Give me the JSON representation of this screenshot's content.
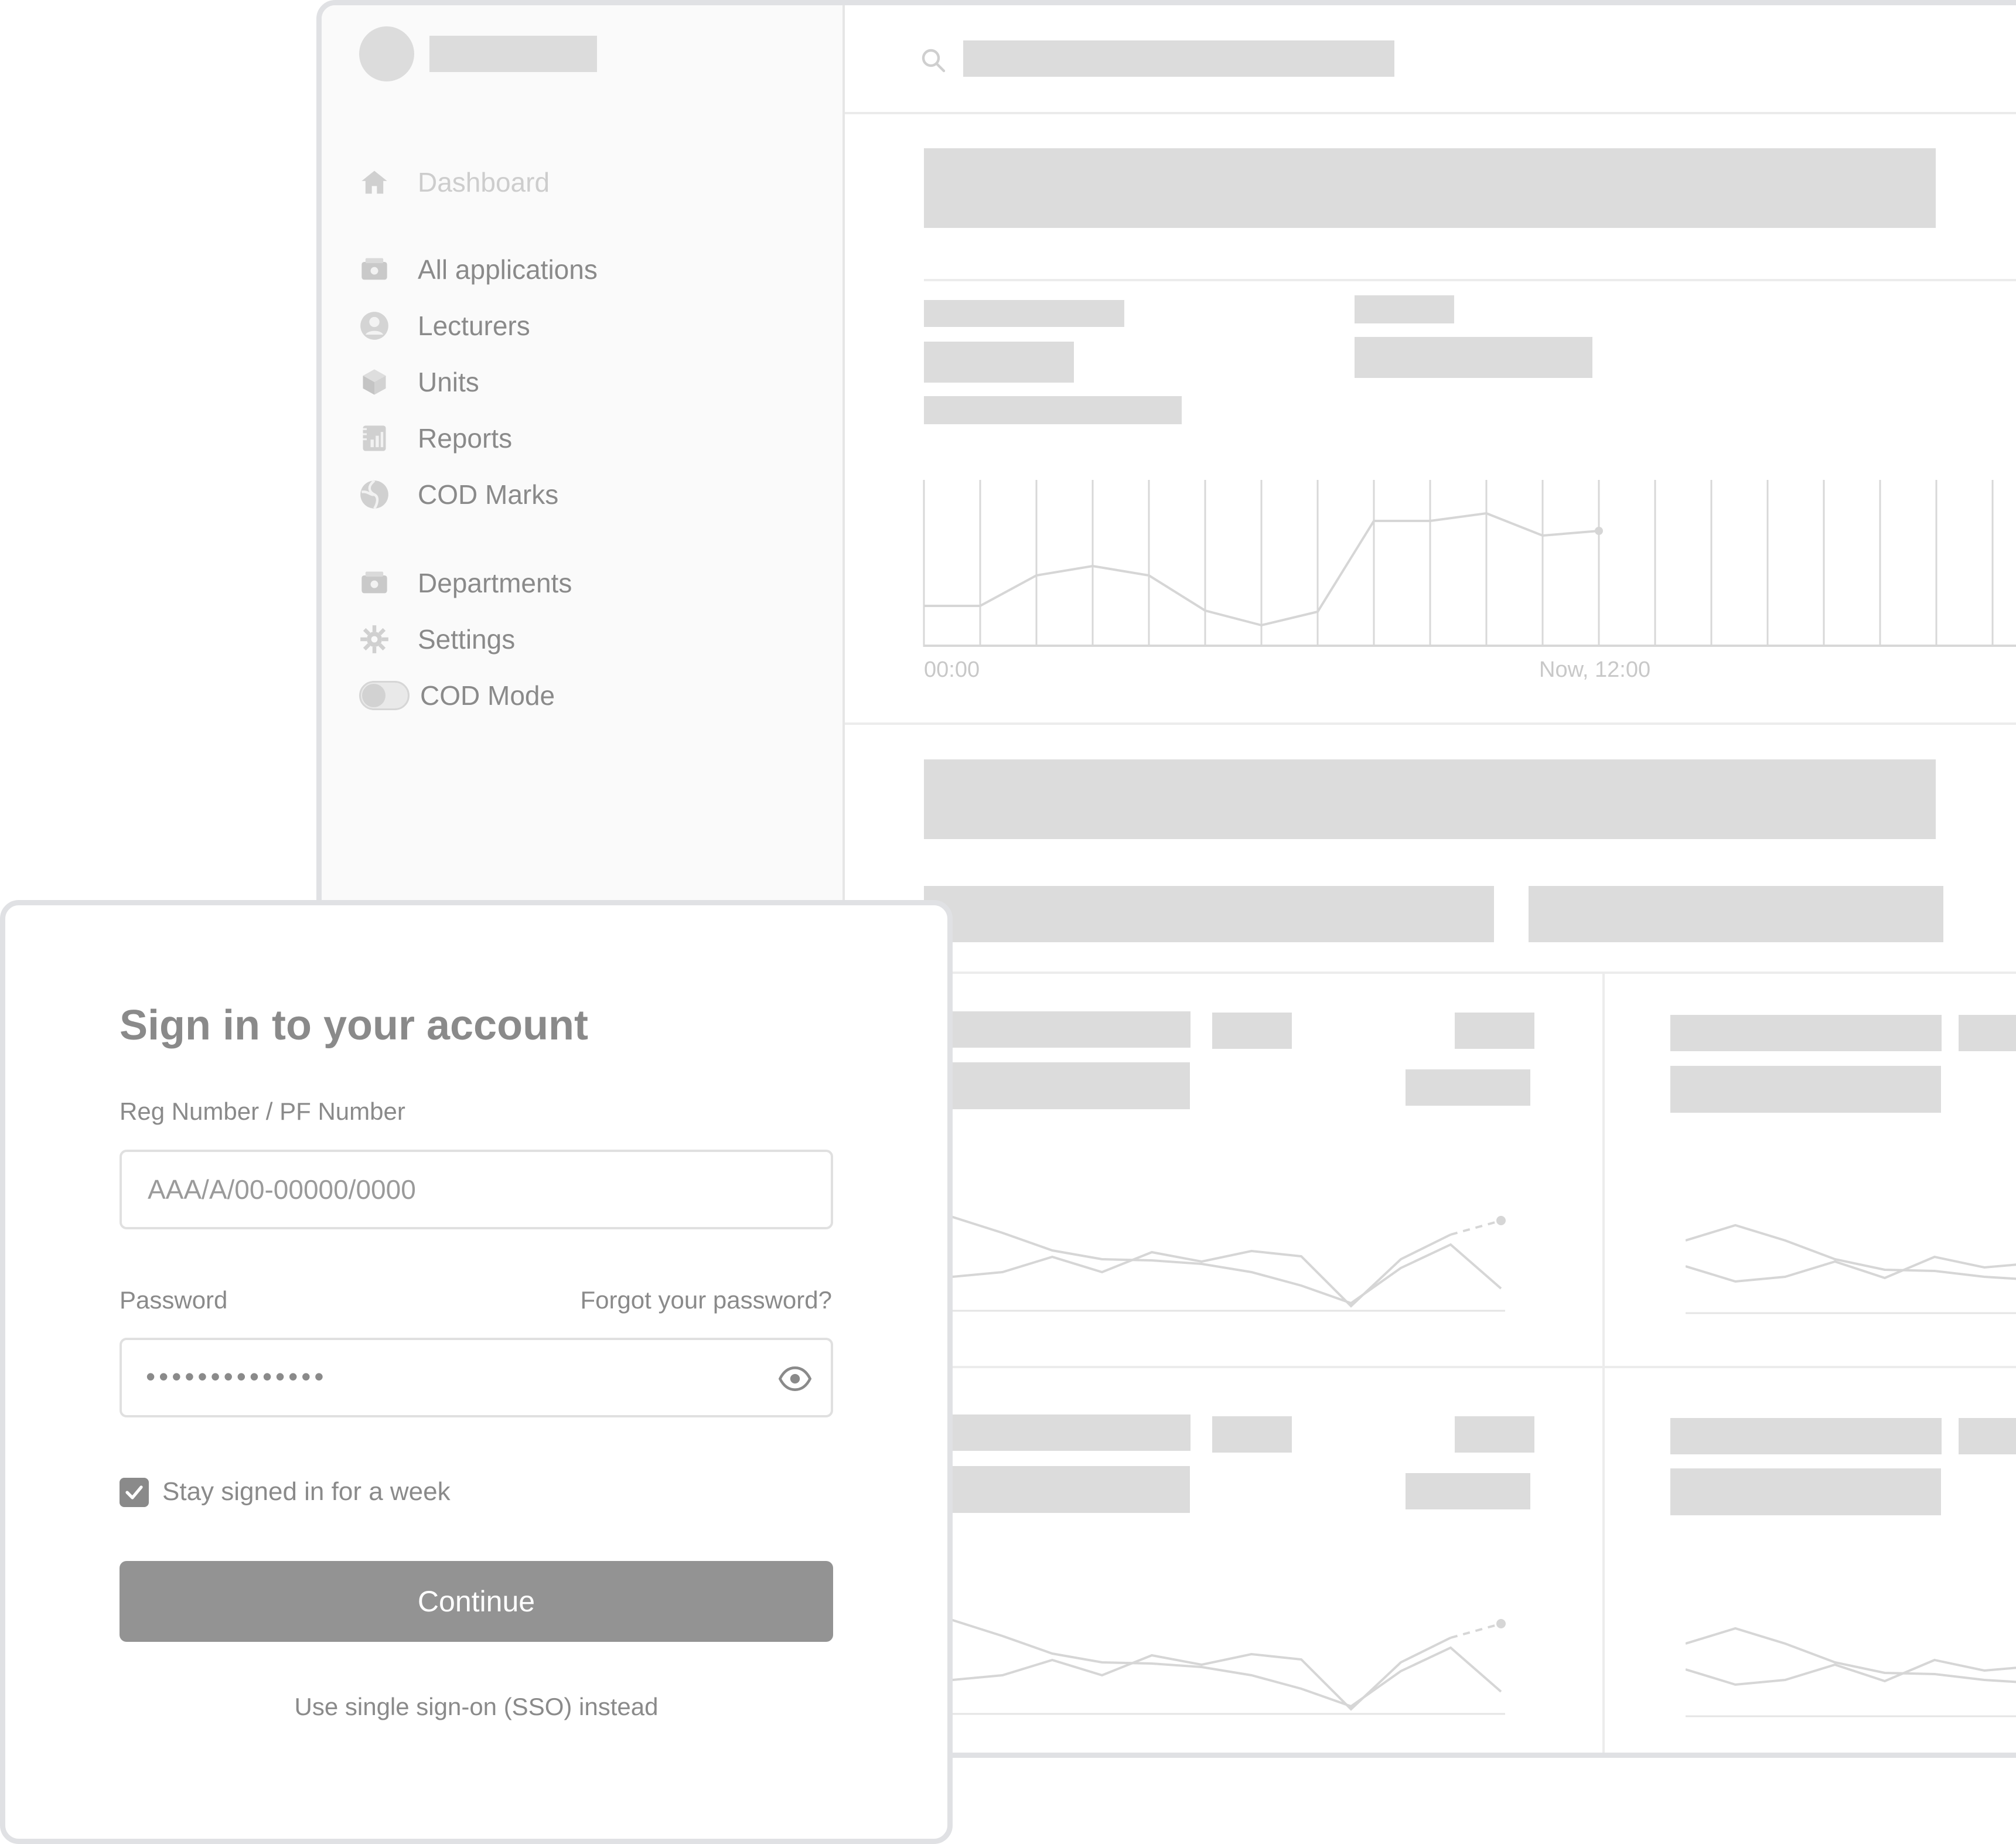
{
  "sidebar": {
    "items": [
      {
        "label": "Dashboard",
        "icon": "home-icon"
      },
      {
        "label": "All applications",
        "icon": "applications-icon"
      },
      {
        "label": "Lecturers",
        "icon": "user-icon"
      },
      {
        "label": "Units",
        "icon": "cube-icon"
      },
      {
        "label": "Reports",
        "icon": "reports-icon"
      },
      {
        "label": "COD Marks",
        "icon": "globe-icon"
      },
      {
        "label": "Departments",
        "icon": "departments-icon"
      },
      {
        "label": "Settings",
        "icon": "gear-icon"
      }
    ],
    "cod_mode": {
      "label": "COD Mode",
      "enabled": false
    }
  },
  "main": {
    "activity_chart": {
      "x_start_label": "00:00",
      "x_now_label": "Now, 12:00"
    }
  },
  "signin": {
    "title": "Sign in to your account",
    "reg_label": "Reg Number / PF Number",
    "reg_placeholder": "AAA/A/00-00000/0000",
    "password_label": "Password",
    "forgot_link": "Forgot your password?",
    "password_masked": "••••••••••••••",
    "stay_signed_in_label": "Stay signed in for a week",
    "stay_signed_in_checked": true,
    "continue_label": "Continue",
    "sso_link": "Use single sign-on (SSO) instead"
  },
  "colors": {
    "text": "#8a8a8a",
    "button": "#939393",
    "skeleton": "#dcdcdc",
    "border": "#e0e1e4"
  }
}
